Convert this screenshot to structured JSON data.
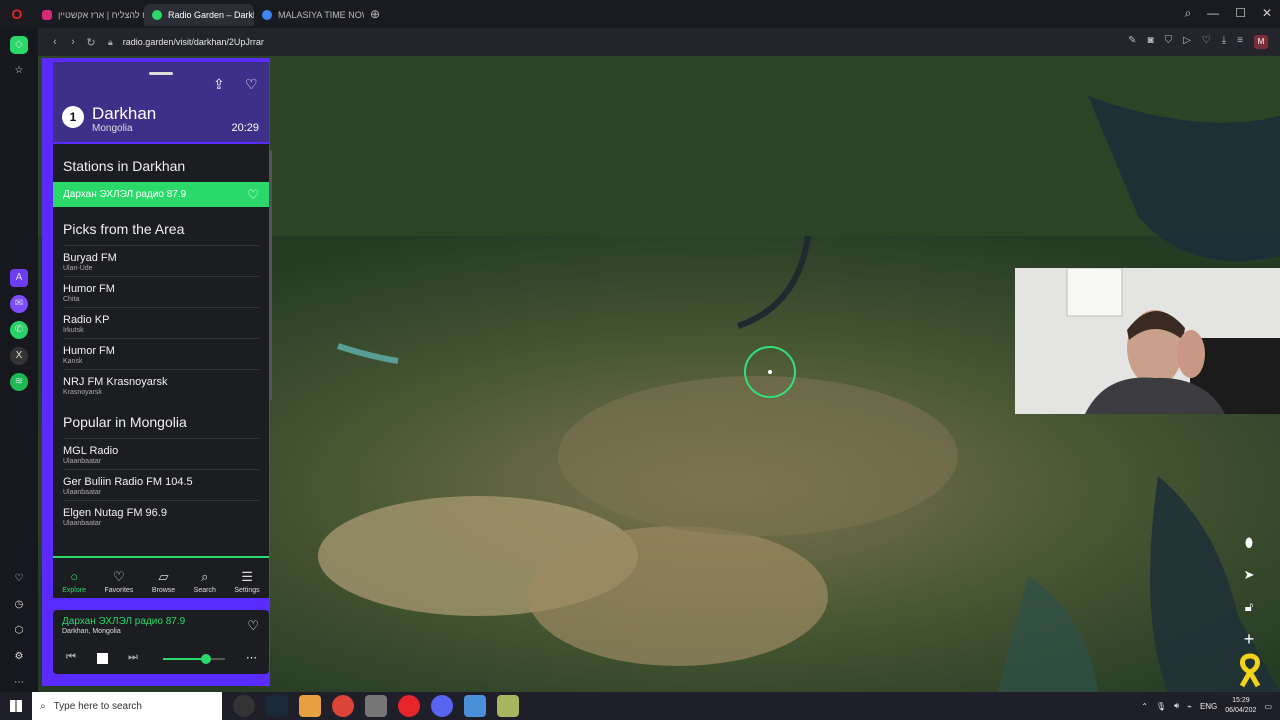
{
  "browser": {
    "tabs": [
      {
        "label": "הכוח להצליח | ארז אקשטיין",
        "color": "#d62976"
      },
      {
        "label": "Radio Garden – Darkh",
        "color": "#2bd96a",
        "active": true
      },
      {
        "label": "MALASIYA TIME NOW - G",
        "color": "#4285f4"
      }
    ],
    "url": "radio.garden/visit/darkhan/2UpJrrar",
    "profile_initial": "M"
  },
  "location": {
    "rank": "1",
    "city": "Darkhan",
    "country": "Mongolia",
    "time": "20:29"
  },
  "sections": {
    "stations_title": "Stations in Darkhan",
    "picks_title": "Picks from the Area",
    "popular_title": "Popular in Mongolia"
  },
  "active_station": "Дархан ЭХЛЭЛ радио 87.9",
  "picks": [
    {
      "name": "Buryad FM",
      "city": "Ulan-Ude"
    },
    {
      "name": "Humor FM",
      "city": "Chita"
    },
    {
      "name": "Radio KP",
      "city": "Irkutsk"
    },
    {
      "name": "Humor FM",
      "city": "Kansk"
    },
    {
      "name": "NRJ FM Krasnoyarsk",
      "city": "Krasnoyarsk"
    }
  ],
  "popular": [
    {
      "name": "MGL Radio",
      "city": "Ulaanbaatar"
    },
    {
      "name": "Ger Buliin Radio FM 104.5",
      "city": "Ulaanbaatar"
    },
    {
      "name": "Elgen Nutag FM 96.9",
      "city": "Ulaanbaatar"
    }
  ],
  "bottom_nav": {
    "explore": "Explore",
    "favorites": "Favorites",
    "browse": "Browse",
    "search": "Search",
    "settings": "Settings"
  },
  "player": {
    "station": "Дархан ЭХЛЭЛ радио 87.9",
    "location": "Darkhan, Mongolia",
    "volume_fraction": 0.7
  },
  "taskbar": {
    "search_placeholder": "Type here to search",
    "language": "ENG",
    "time": "15:29",
    "date": "06/04/202"
  }
}
